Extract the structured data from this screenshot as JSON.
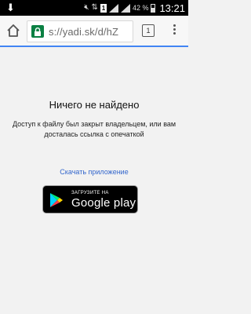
{
  "status_bar": {
    "battery_percent": "42 %",
    "time": "13:21",
    "sim_label": "1"
  },
  "toolbar": {
    "url": "s://yadi.sk/d/hZ",
    "tab_count": "1"
  },
  "content": {
    "title": "Ничего не найдено",
    "message": "Доступ к файлу был закрыт владельцем, или вам досталась ссылка с опечаткой",
    "download_link": "Скачать приложение",
    "google_play_small": "ЗАГРУЗИТЕ НА",
    "google_play_big": "Google play"
  },
  "colors": {
    "lock_green": "#0b8043",
    "link_blue": "#3366cc",
    "progress_blue": "#4285f4"
  },
  "icons": {
    "status_left": "download-icon",
    "home": "home-icon",
    "lock": "lock-icon",
    "menu": "overflow-menu-icon",
    "play": "google-play-icon"
  }
}
